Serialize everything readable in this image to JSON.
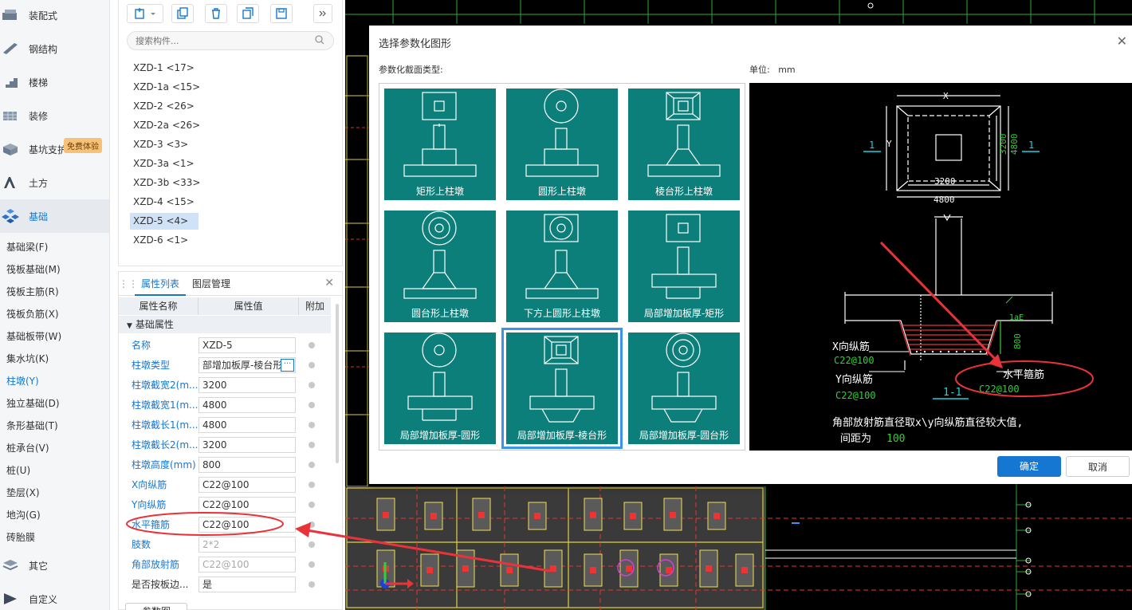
{
  "sidebar": {
    "categories_top": [
      {
        "label": "装配式",
        "icon": "prefab-icon"
      },
      {
        "label": "钢结构",
        "icon": "steel-structure-icon"
      },
      {
        "label": "楼梯",
        "icon": "stairs-icon"
      },
      {
        "label": "装修",
        "icon": "decoration-icon"
      },
      {
        "label": "基坑支护",
        "icon": "pit-support-icon"
      },
      {
        "label": "土方",
        "icon": "earthwork-icon"
      },
      {
        "label": "基础",
        "icon": "foundation-icon"
      }
    ],
    "badge": "免费体验",
    "subitems": [
      "基础梁(F)",
      "筏板基础(M)",
      "筏板主筋(R)",
      "筏板负筋(X)",
      "基础板带(W)",
      "集水坑(K)",
      "柱墩(Y)",
      "独立基础(D)",
      "条形基础(T)",
      "桩承台(V)",
      "桩(U)",
      "垫层(X)",
      "地沟(G)",
      "砖胎膜"
    ],
    "active_sub": "柱墩(Y)",
    "categories_bottom": [
      {
        "label": "其它",
        "icon": "other-icon"
      },
      {
        "label": "自定义",
        "icon": "custom-icon"
      }
    ]
  },
  "component_list": {
    "search_placeholder": "搜索构件...",
    "items": [
      "XZD-1 <17>",
      "XZD-1a <15>",
      "XZD-2 <26>",
      "XZD-2a <26>",
      "XZD-3 <3>",
      "XZD-3a <1>",
      "XZD-3b <33>",
      "XZD-4 <15>",
      "XZD-5 <4>",
      "XZD-6 <1>"
    ],
    "selected": "XZD-5 <4>"
  },
  "properties": {
    "tabs": [
      "属性列表",
      "图层管理"
    ],
    "headers": [
      "属性名称",
      "属性值",
      "附加"
    ],
    "group": "基础属性",
    "rows": [
      {
        "name": "名称",
        "value": "XZD-5"
      },
      {
        "name": "柱墩类型",
        "value": "部增加板厚-棱台形"
      },
      {
        "name": "柱墩截宽2(m...",
        "value": "3200"
      },
      {
        "name": "柱墩截宽1(m...",
        "value": "4800"
      },
      {
        "name": "柱墩截长1(m...",
        "value": "4800"
      },
      {
        "name": "柱墩截长2(m...",
        "value": "3200"
      },
      {
        "name": "柱墩高度(mm)",
        "value": "800"
      },
      {
        "name": "X向纵筋",
        "value": "C22@100"
      },
      {
        "name": "Y向纵筋",
        "value": "C22@100"
      },
      {
        "name": "水平箍筋",
        "value": "C22@100"
      },
      {
        "name": "肢数",
        "value": "2*2"
      },
      {
        "name": "角部放射筋",
        "value": "C22@100"
      },
      {
        "name": "是否按板边...",
        "value": "是"
      }
    ],
    "bottom_button": "参数图"
  },
  "dialog": {
    "title": "选择参数化图形",
    "section_label": "参数化截面类型:",
    "unit_label": "单位:",
    "unit_value": "mm",
    "shapes": [
      "矩形上柱墩",
      "圆形上柱墩",
      "棱台形上柱墩",
      "圆台形上柱墩",
      "下方上圆形上柱墩",
      "局部增加板厚-矩形",
      "局部增加板厚-圆形",
      "局部增加板厚-棱台形",
      "局部增加板厚-圆台形"
    ],
    "selected_shape": "局部增加板厚-棱台形",
    "preview": {
      "dim_x": "X",
      "dim_y": "Y",
      "section_mark": "1",
      "width_inner": "3200",
      "width_outer": "4800",
      "height_inner": "3200",
      "height_outer": "4800",
      "lae": "1aE",
      "height": "800",
      "x_bar_label": "X向纵筋",
      "x_bar_value": "C22@100",
      "y_bar_label": "Y向纵筋",
      "y_bar_value": "C22@100",
      "stirrup_label": "水平箍筋",
      "stirrup_value": "C22@100",
      "section_title": "1-1",
      "note_line1": "角部放射筋直径取x\\y向纵筋直径较大值,",
      "note_line2_prefix": "间距为",
      "note_line2_value": "100"
    },
    "ok": "确定",
    "cancel": "取消"
  }
}
